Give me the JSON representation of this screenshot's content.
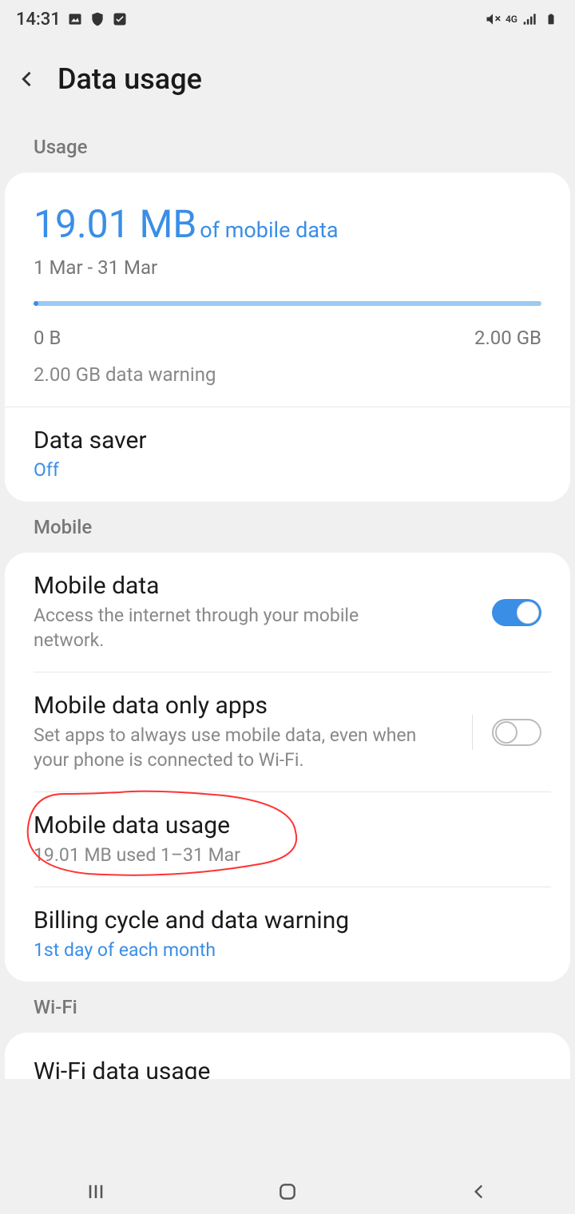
{
  "statusBar": {
    "time": "14:31",
    "network": "4G"
  },
  "header": {
    "title": "Data usage"
  },
  "usage": {
    "sectionLabel": "Usage",
    "amount": "19.01 MB",
    "suffix": "of mobile data",
    "period": "1 Mar - 31 Mar",
    "min": "0 B",
    "max": "2.00 GB",
    "warning": "2.00 GB data warning",
    "dataSaver": {
      "title": "Data saver",
      "status": "Off"
    }
  },
  "mobile": {
    "sectionLabel": "Mobile",
    "mobileData": {
      "title": "Mobile data",
      "subtitle": "Access the internet through your mobile network.",
      "enabled": true
    },
    "mobileDataOnly": {
      "title": "Mobile data only apps",
      "subtitle": "Set apps to always use mobile data, even when your phone is connected to Wi-Fi.",
      "enabled": false
    },
    "mobileDataUsage": {
      "title": "Mobile data usage",
      "subtitle": "19.01 MB used 1–31 Mar"
    },
    "billingCycle": {
      "title": "Billing cycle and data warning",
      "subtitle": "1st day of each month"
    }
  },
  "wifi": {
    "sectionLabel": "Wi-Fi",
    "wifiDataUsage": {
      "title": "Wi-Fi data usage"
    }
  }
}
